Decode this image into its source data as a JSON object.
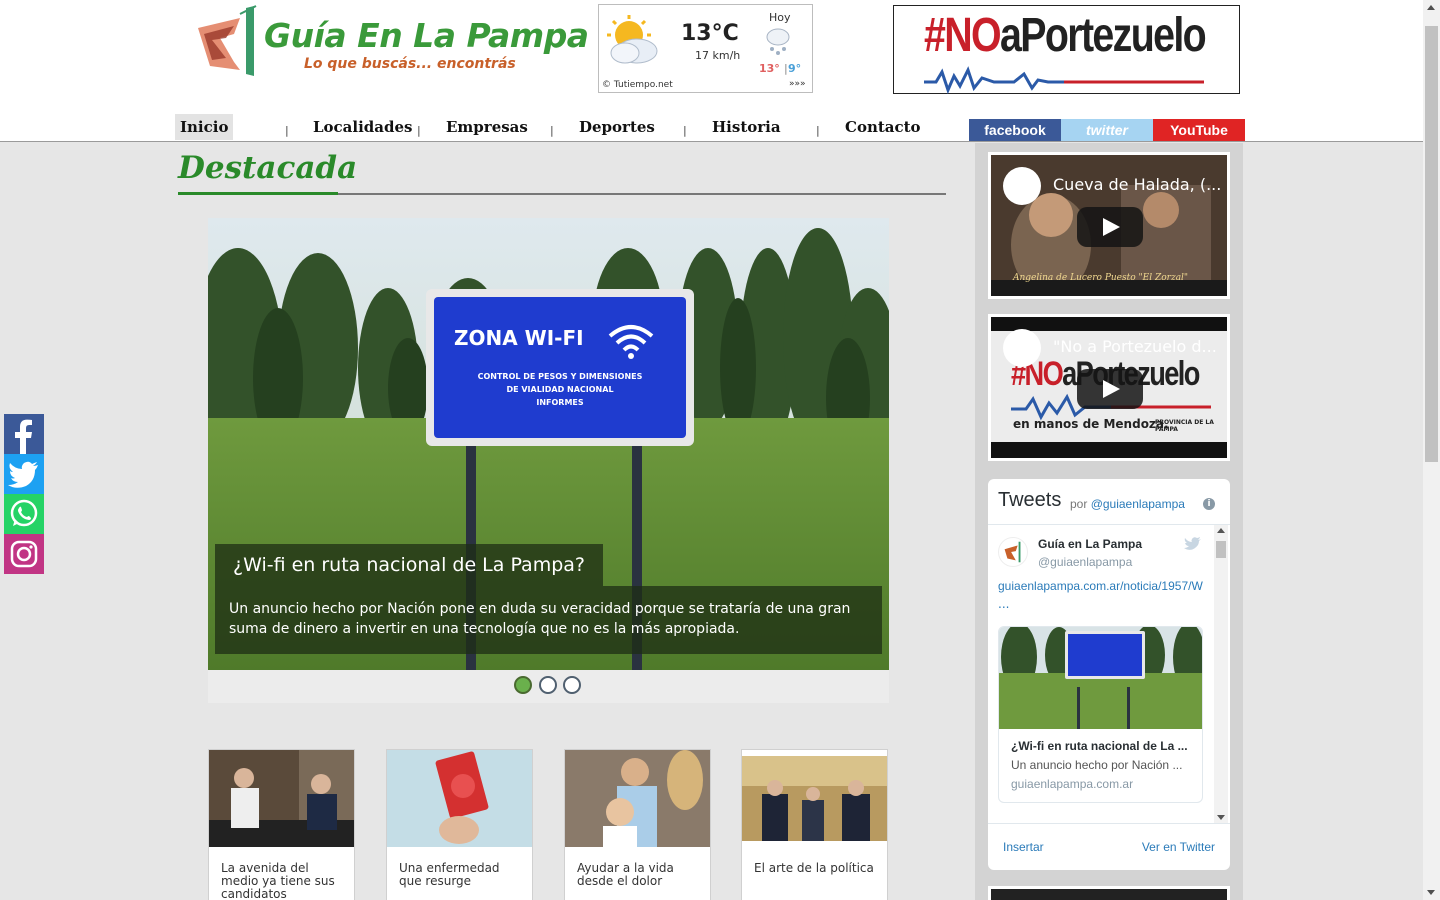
{
  "site": {
    "title": "Guía En La Pampa",
    "tagline": "Lo que buscás... encontrás"
  },
  "weather": {
    "temperature": "13°C",
    "wind": "17 km/h",
    "today_label": "Hoy",
    "high": "13°",
    "separator": "|",
    "low": "9°",
    "source": "© Tutiempo.net",
    "more": "»»»",
    "icon_current": "partly-cloudy-icon",
    "icon_today": "snow-cloud-icon"
  },
  "banner": {
    "prefix": "#NO",
    "text": "aPortezuelo"
  },
  "nav": {
    "items": [
      {
        "label": "Inicio",
        "active": true
      },
      {
        "label": "Localidades"
      },
      {
        "label": "Empresas"
      },
      {
        "label": "Deportes"
      },
      {
        "label": "Historia"
      },
      {
        "label": "Contacto"
      }
    ],
    "separator": "|"
  },
  "social": {
    "facebook": "facebook",
    "twitter": "twitter",
    "youtube": "YouTube"
  },
  "section": {
    "title": "Destacada"
  },
  "slider": {
    "sign_title": "ZONA WI-FI",
    "sign_line1": "CONTROL DE PESOS Y DIMENSIONES",
    "sign_line2": "DE VIALIDAD NACIONAL",
    "sign_line3": "INFORMES",
    "caption_title": "¿Wi-fi en ruta nacional de La Pampa?",
    "caption_text": "Un anuncio hecho por Nación pone en duda su veracidad porque se trataría de una gran suma de dinero a invertir en una tecnología que no es la más apropiada.",
    "dot_count": 3,
    "active_dot": 1
  },
  "cards": [
    {
      "title": "La avenida del medio ya tiene sus candidatos"
    },
    {
      "title": "Una enfermedad que resurge"
    },
    {
      "title": "Ayudar a la vida desde el dolor"
    },
    {
      "title": "El arte de la política"
    }
  ],
  "videos": [
    {
      "title": "Cueva de Halada, (...",
      "caption": "Angelina de Lucero   Puesto \"El Zorzal\""
    },
    {
      "title": "\"No a Portezuelo d...",
      "overlay_prefix": "#NO",
      "overlay_text": "aPortezuelo",
      "caption": "en manos de Mendoza.",
      "province": "PROVINCIA DE LA PAMPA"
    }
  ],
  "tweets": {
    "heading": "Tweets",
    "by": "por",
    "account": "@guiaenlapampa",
    "info": "i",
    "name": "Guía en La Pampa",
    "handle": "@guiaenlapampa",
    "link": "guiaenlapampa.com.ar/noticia/1957/W",
    "ellipsis": "...",
    "card_title": "¿Wi-fi en ruta nacional de La ...",
    "card_desc": "Un anuncio hecho por Nación ...",
    "card_domain": "guiaenlapampa.com.ar",
    "embed": "Insertar",
    "view": "Ver en Twitter"
  },
  "share": [
    "facebook-icon",
    "twitter-icon",
    "whatsapp-icon",
    "instagram-icon"
  ],
  "colors": {
    "brand_green": "#2a8a2a",
    "brand_orange": "#c8602a",
    "facebook": "#3b5998",
    "twitter": "#a6d4f2",
    "youtube": "#e02424",
    "whatsapp": "#25d366",
    "instagram": "#c13584"
  }
}
